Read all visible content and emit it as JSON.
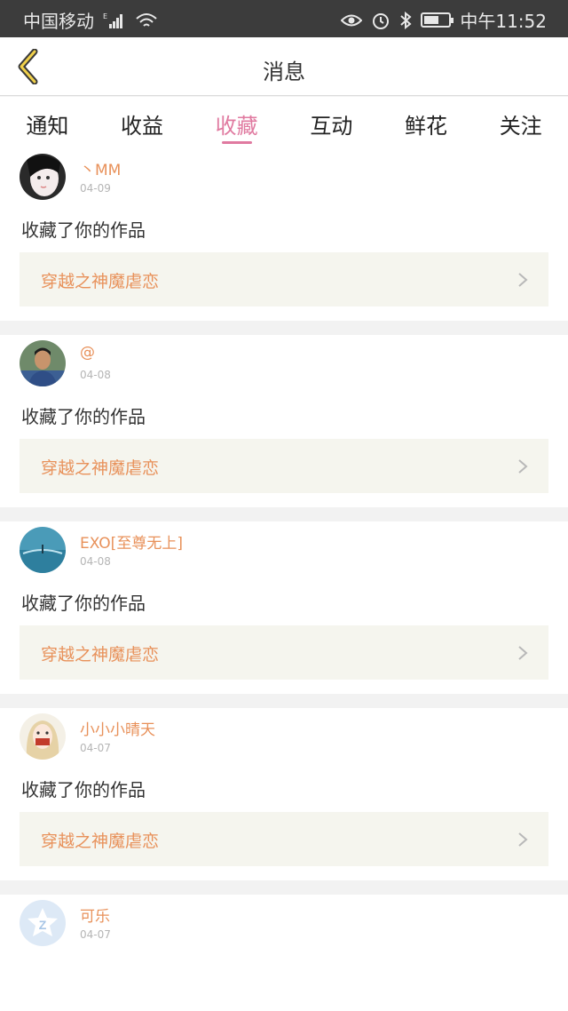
{
  "status": {
    "carrier": "中国移动",
    "net_badge": "E",
    "time": "中午11:52"
  },
  "header": {
    "title": "消息"
  },
  "tabs": [
    {
      "label": "通知"
    },
    {
      "label": "收益"
    },
    {
      "label": "收藏",
      "active": true
    },
    {
      "label": "互动"
    },
    {
      "label": "鲜花"
    },
    {
      "label": "关注"
    }
  ],
  "accent_color": "#e07aa0",
  "name_color": "#e8915a",
  "messages": [
    {
      "user": "丶MM",
      "date": "04-09",
      "action": "收藏了你的作品",
      "work": "穿越之神魔虐恋"
    },
    {
      "user": "@",
      "date": "04-08",
      "action": "收藏了你的作品",
      "work": "穿越之神魔虐恋"
    },
    {
      "user": "EXO[至尊无上]",
      "date": "04-08",
      "action": "收藏了你的作品",
      "work": "穿越之神魔虐恋"
    },
    {
      "user": "小小小晴天",
      "date": "04-07",
      "action": "收藏了你的作品",
      "work": "穿越之神魔虐恋"
    },
    {
      "user": "可乐",
      "date": "04-07"
    }
  ]
}
